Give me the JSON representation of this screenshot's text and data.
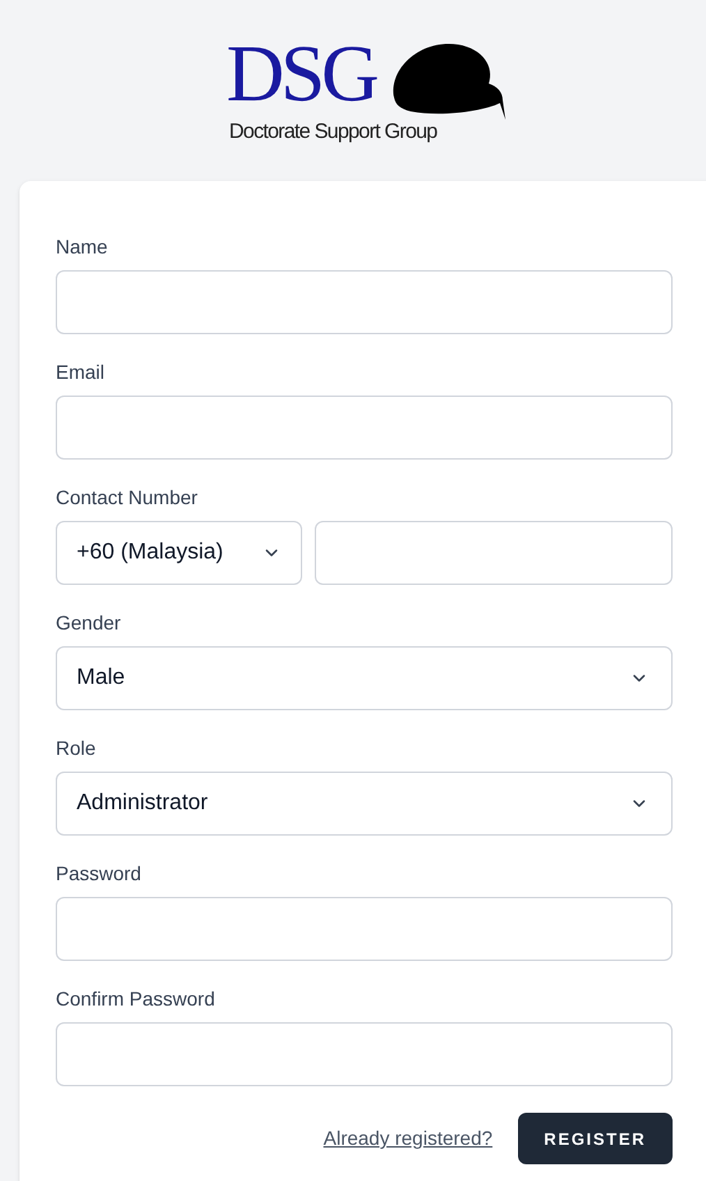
{
  "logo": {
    "initials": "DSG",
    "name": "Doctorate Support Group"
  },
  "fields": [
    {
      "label": "Name",
      "kind": "text"
    },
    {
      "label": "Email",
      "kind": "text"
    },
    {
      "label": "Contact Number",
      "kind": "phone",
      "value": "+60 (Malaysia)"
    },
    {
      "label": "Gender",
      "kind": "select",
      "value": "Male"
    },
    {
      "label": "Role",
      "kind": "select",
      "value": "Administrator"
    },
    {
      "label": "Password",
      "kind": "text"
    },
    {
      "label": "Confirm Password",
      "kind": "text"
    }
  ],
  "link": "Already registered?",
  "button": "REGISTER"
}
